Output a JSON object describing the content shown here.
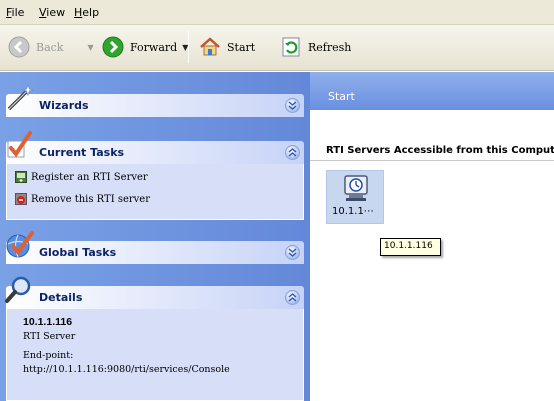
{
  "menu": {
    "file": "File",
    "view": "View",
    "help": "Help"
  },
  "toolbar": {
    "back": "Back",
    "forward": "Forward",
    "start": "Start",
    "refresh": "Refresh"
  },
  "left": {
    "wizards": {
      "title": "Wizards"
    },
    "current_tasks": {
      "title": "Current Tasks",
      "items": [
        "Register an RTI Server",
        "Remove this RTI server"
      ]
    },
    "global_tasks": {
      "title": "Global Tasks"
    },
    "details": {
      "title": "Details",
      "name": "10.1.1.116",
      "type": "RTI Server",
      "endpoint_label": "End-point:",
      "endpoint_value": "http://10.1.1.116:9080/rti/services/Console"
    }
  },
  "right": {
    "title": "Start",
    "section_heading": "RTI Servers Accessible from this Computer",
    "server_tile_label": "10.1.1⋯",
    "tooltip": "10.1.1.116"
  },
  "colors": {
    "task_pane_bg": "#6d8fde",
    "header_text": "#215dc6",
    "body_bg": "#d6dff7",
    "tooltip_bg": "#ffffe1"
  }
}
